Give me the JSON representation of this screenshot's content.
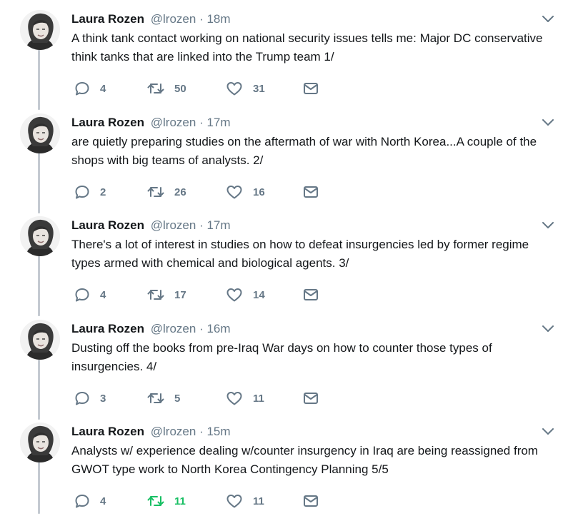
{
  "tweets": [
    {
      "name": "Laura Rozen",
      "handle": "@lrozen",
      "dot": "·",
      "time": "18m",
      "text": "A think tank contact working on national security issues tells me: Major DC conservative think tanks that are linked into the Trump team 1/",
      "replies": "4",
      "retweets": "50",
      "likes": "31",
      "retweeted": false
    },
    {
      "name": "Laura Rozen",
      "handle": "@lrozen",
      "dot": "·",
      "time": "17m",
      "text": "are quietly preparing studies on the aftermath of war with North Korea...A couple of the shops with big teams of analysts. 2/",
      "replies": "2",
      "retweets": "26",
      "likes": "16",
      "retweeted": false
    },
    {
      "name": "Laura Rozen",
      "handle": "@lrozen",
      "dot": "·",
      "time": "17m",
      "text": "There's a lot of interest in studies on how to defeat insurgencies led by former regime types armed with chemical and biological agents. 3/",
      "replies": "4",
      "retweets": "17",
      "likes": "14",
      "retweeted": false
    },
    {
      "name": "Laura Rozen",
      "handle": "@lrozen",
      "dot": "·",
      "time": "16m",
      "text": "Dusting off the books from pre-Iraq War days on how to counter those types of insurgencies. 4/",
      "replies": "3",
      "retweets": "5",
      "likes": "11",
      "retweeted": false
    },
    {
      "name": "Laura Rozen",
      "handle": "@lrozen",
      "dot": "·",
      "time": "15m",
      "text": "Analysts w/ experience dealing w/counter insurgency in Iraq are being reassigned from GWOT type work to North Korea Contingency Planning 5/5",
      "replies": "4",
      "retweets": "11",
      "likes": "11",
      "retweeted": true
    }
  ],
  "icons": {
    "reply": "reply-icon",
    "retweet": "retweet-icon",
    "like": "heart-icon",
    "dm": "envelope-icon",
    "more": "chevron-down-icon",
    "avatar": "avatar"
  },
  "colors": {
    "text": "#14171a",
    "secondary": "#657786",
    "retweet_active": "#17bf63",
    "thread_line": "#c4cad1"
  }
}
